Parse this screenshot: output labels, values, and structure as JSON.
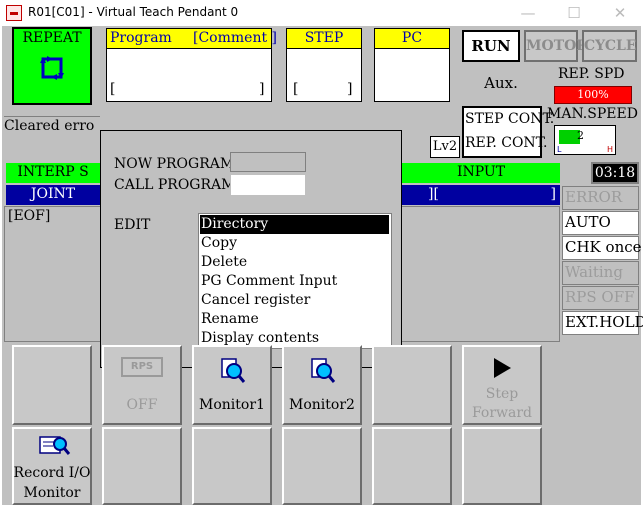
{
  "window": {
    "title": "R01[C01] - Virtual Teach Pendant 0",
    "minimize": "—",
    "maximize": "☐",
    "close": "✕"
  },
  "repeat_button": {
    "label": "REPEAT"
  },
  "header": {
    "program_label": "Program",
    "comment_label": "[Comment ]",
    "program_value_open": "[",
    "program_value_close": "]",
    "step_label": "STEP",
    "step_value_open": "[",
    "step_value_close": "]",
    "pc_label": "PC"
  },
  "top_buttons": {
    "run": "RUN",
    "motor": "MOTOR",
    "cycle": "CYCLE"
  },
  "aux_label": "Aux.",
  "rep_speed": {
    "label": "REP. SPD",
    "value": "100%"
  },
  "man_speed": {
    "label": "MAN.SPEED",
    "value": "2",
    "low": "L",
    "high": "H",
    "level_fraction": 0.4
  },
  "step_cont": {
    "line1": "STEP CONT.",
    "line2": "REP. CONT."
  },
  "level": "Lv2",
  "clock": "03:18",
  "message": "Cleared erro",
  "interp": {
    "label": "INTERP S",
    "input_label": "INPUT"
  },
  "joint": {
    "label": "JOINT",
    "bracket_text": "]["
  },
  "listing": {
    "eof": "[EOF]"
  },
  "side_buttons": [
    "ERROR",
    "AUTO",
    "CHK once",
    "Waiting",
    "RPS OFF",
    "EXT.HOLD"
  ],
  "popup": {
    "now_program_label": "NOW PROGRAM",
    "call_program_label": "CALL PROGRAM",
    "edit_label": "EDIT",
    "menu": [
      "Directory",
      "Copy",
      "Delete",
      "PG Comment Input",
      "Cancel register",
      "Rename",
      "Display contents"
    ],
    "selected_index": 0
  },
  "function_buttons": {
    "rps_icon": "RPS",
    "rps_label": "OFF",
    "monitor1": "Monitor1",
    "monitor2": "Monitor2",
    "step_forward_line1": "Step",
    "step_forward_line2": "Forward",
    "record_io_line1": "Record I/O",
    "record_io_line2": "Monitor"
  },
  "colors": {
    "background": "#c0c0c0",
    "repeat_green": "#00ff00",
    "header_yellow": "#ffff00",
    "rep_speed_red": "#ff0000",
    "joint_blue": "#0000a0",
    "selection_black": "#000000"
  }
}
